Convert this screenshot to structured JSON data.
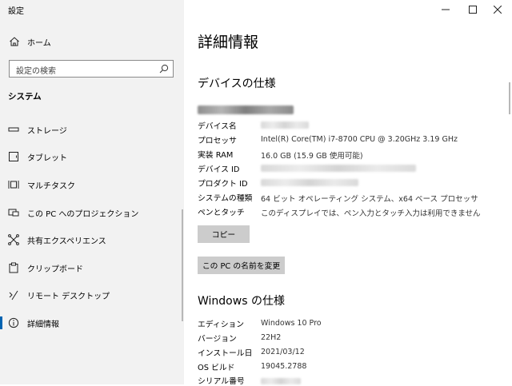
{
  "window": {
    "title": "設定",
    "controls": {
      "minimize": "—",
      "maximize": "☐",
      "close": "✕"
    }
  },
  "sidebar": {
    "home": {
      "label": "ホーム",
      "icon": "home-icon"
    },
    "search": {
      "placeholder": "設定の検索",
      "icon": "search-icon"
    },
    "section": "システム",
    "items": [
      {
        "label": "ストレージ",
        "icon": "storage-icon",
        "active": false
      },
      {
        "label": "タブレット",
        "icon": "tablet-icon",
        "active": false
      },
      {
        "label": "マルチタスク",
        "icon": "multitask-icon",
        "active": false
      },
      {
        "label": "この PC へのプロジェクション",
        "icon": "projection-icon",
        "active": false
      },
      {
        "label": "共有エクスペリエンス",
        "icon": "shared-experiences-icon",
        "active": false
      },
      {
        "label": "クリップボード",
        "icon": "clipboard-icon",
        "active": false
      },
      {
        "label": "リモート デスクトップ",
        "icon": "remote-desktop-icon",
        "active": false
      },
      {
        "label": "詳細情報",
        "icon": "info-icon",
        "active": true
      }
    ]
  },
  "main": {
    "title": "詳細情報",
    "device_spec": {
      "heading": "デバイスの仕様",
      "rows": [
        {
          "label": "デバイス名",
          "value": ""
        },
        {
          "label": "プロセッサ",
          "value": "Intel(R) Core(TM) i7-8700 CPU @ 3.20GHz   3.19 GHz"
        },
        {
          "label": "実装 RAM",
          "value": "16.0 GB (15.9 GB 使用可能)"
        },
        {
          "label": "デバイス ID",
          "value": ""
        },
        {
          "label": "プロダクト ID",
          "value": ""
        },
        {
          "label": "システムの種類",
          "value": "64 ビット オペレーティング システム、x64 ベース プロセッサ"
        },
        {
          "label": "ペンとタッチ",
          "value": "このディスプレイでは、ペン入力とタッチ入力は利用できません"
        }
      ],
      "copy_button": "コピー",
      "rename_button": "この PC の名前を変更"
    },
    "windows_spec": {
      "heading": "Windows の仕様",
      "rows": [
        {
          "label": "エディション",
          "value": "Windows 10 Pro"
        },
        {
          "label": "バージョン",
          "value": "22H2"
        },
        {
          "label": "インストール日",
          "value": "2021/03/12"
        },
        {
          "label": "OS ビルド",
          "value": "19045.2788"
        },
        {
          "label": "シリアル番号",
          "value": ""
        }
      ]
    }
  },
  "colors": {
    "sidebar_bg": "#f2f2f2",
    "accent": "#0063b1",
    "button_bg": "#cccccc"
  }
}
